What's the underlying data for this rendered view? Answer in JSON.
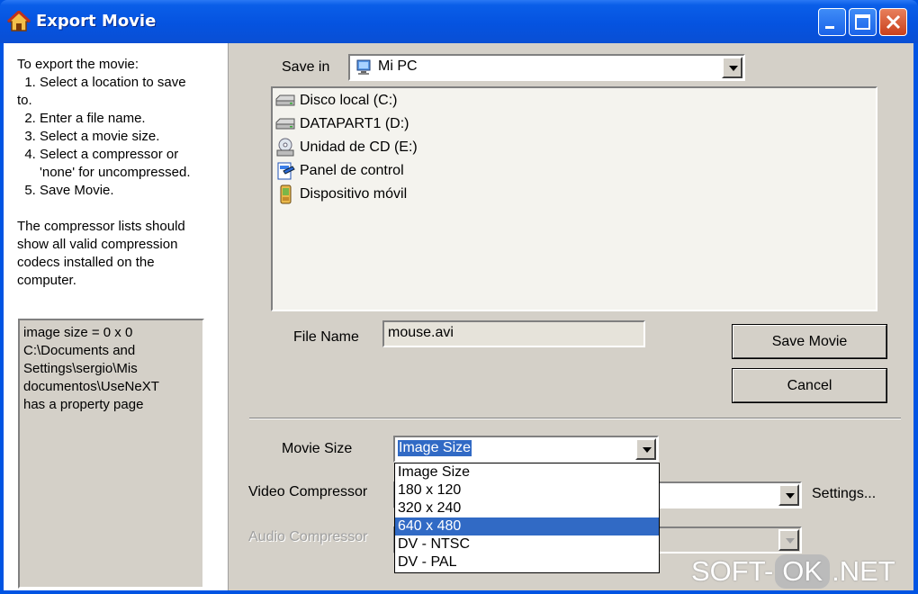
{
  "window": {
    "title": "Export Movie"
  },
  "instructions": {
    "lines": [
      "To export the movie:",
      "  1. Select a location to save",
      "to.",
      "  2. Enter a file name.",
      "  3. Select a movie size.",
      "  4. Select a compressor or",
      "      'none' for uncompressed.",
      "  5. Save Movie.",
      "",
      "The compressor lists should",
      "show all valid compression",
      "codecs installed on the",
      "computer."
    ]
  },
  "info_box": {
    "lines": [
      "image size = 0 x 0",
      "C:\\Documents and",
      "Settings\\sergio\\Mis",
      "documentos\\UseNeXT",
      "has a property page"
    ]
  },
  "save_in": {
    "label": "Save in",
    "value": "Mi PC"
  },
  "locations": [
    {
      "label": "Disco local (C:)",
      "icon": "drive-icon"
    },
    {
      "label": "DATAPART1 (D:)",
      "icon": "drive-icon"
    },
    {
      "label": "Unidad de CD (E:)",
      "icon": "cd-drive-icon"
    },
    {
      "label": "Panel de control",
      "icon": "control-panel-icon"
    },
    {
      "label": "Dispositivo móvil",
      "icon": "mobile-device-icon"
    }
  ],
  "file_name": {
    "label": "File Name",
    "value": "mouse.avi"
  },
  "buttons": {
    "save": "Save Movie",
    "cancel": "Cancel"
  },
  "movie_size": {
    "label": "Movie Size",
    "value": "Image Size",
    "options": [
      "Image Size",
      "180 x 120",
      "320 x 240",
      "640 x 480",
      "DV - NTSC",
      "DV - PAL"
    ],
    "highlighted": "640 x 480"
  },
  "video_compressor": {
    "label": "Video Compressor",
    "settings": "Settings..."
  },
  "audio_compressor": {
    "label": "Audio Compressor"
  },
  "watermark": {
    "left": "SOFT-",
    "middle": "OK",
    "right": ".NET"
  }
}
